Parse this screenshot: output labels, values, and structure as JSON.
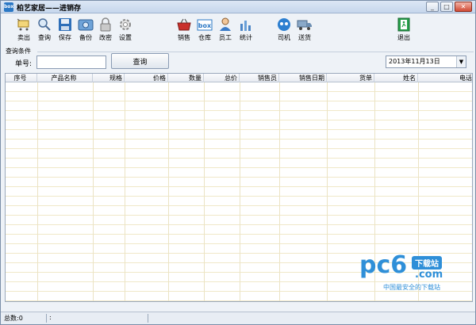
{
  "window": {
    "icon_text": "box",
    "title": "柏艺家居——进销存",
    "buttons": [
      "_",
      "□",
      "✕"
    ]
  },
  "toolbar": [
    {
      "label": "卖出",
      "icon": "cart-sell-icon"
    },
    {
      "label": "查询",
      "icon": "magnifier-icon"
    },
    {
      "label": "保存",
      "icon": "save-icon"
    },
    {
      "label": "备份",
      "icon": "backup-icon"
    },
    {
      "label": "改密",
      "icon": "lock-icon"
    },
    {
      "label": "设置",
      "icon": "gear-icon"
    },
    {
      "label": "销售",
      "icon": "basket-icon"
    },
    {
      "label": "仓库",
      "icon": "box-icon"
    },
    {
      "label": "员工",
      "icon": "person-icon"
    },
    {
      "label": "统计",
      "icon": "chart-icon"
    },
    {
      "label": "司机",
      "icon": "driver-icon"
    },
    {
      "label": "送货",
      "icon": "truck-icon"
    },
    {
      "label": "退出",
      "icon": "exit-icon"
    }
  ],
  "query": {
    "group_title": "查询条件",
    "order_label": "单号:",
    "order_value": "",
    "query_button": "查询",
    "date_value": "2013年11月13日"
  },
  "grid": {
    "columns": [
      "序号",
      "产品名称",
      "规格",
      "价格",
      "数量",
      "总价",
      "销售员",
      "销售日期",
      "货单",
      "姓名",
      "电话"
    ]
  },
  "watermark": {
    "logo": "pc6",
    "badge": "下载站",
    "domain": ".com",
    "slogan": "中国最安全的下载站"
  },
  "status": {
    "total": "总数:0",
    "sep": ":"
  },
  "colors": {
    "accent": "#2b78c5",
    "grid_line": "#f0e8c8"
  }
}
